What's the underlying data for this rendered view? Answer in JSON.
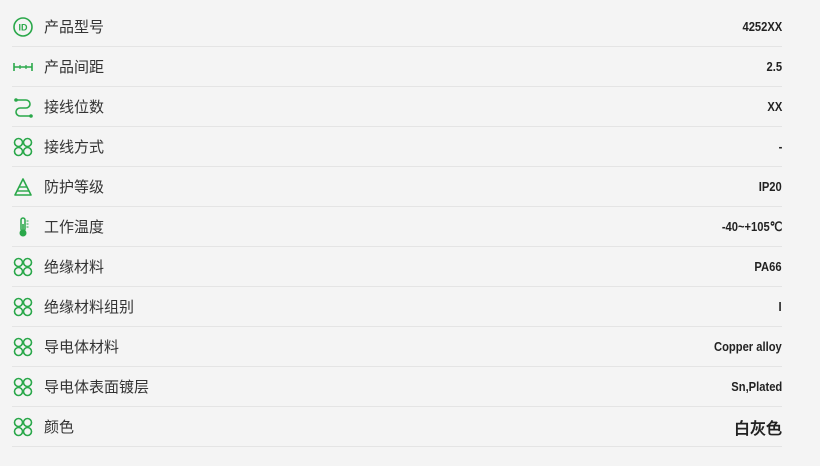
{
  "accent_color": "#2aa84a",
  "specs": [
    {
      "icon": "id-icon",
      "label": "产品型号",
      "value": "4252XX"
    },
    {
      "icon": "pitch-icon",
      "label": "产品间距",
      "value": "2.5"
    },
    {
      "icon": "wiring-icon",
      "label": "接线位数",
      "value": "XX"
    },
    {
      "icon": "clover-icon",
      "label": "接线方式",
      "value": "-"
    },
    {
      "icon": "cone-icon",
      "label": "防护等级",
      "value": "IP20"
    },
    {
      "icon": "thermometer-icon",
      "label": "工作温度",
      "value": "-40~+105℃"
    },
    {
      "icon": "clover-icon",
      "label": "绝缘材料",
      "value": "PA66"
    },
    {
      "icon": "clover-icon",
      "label": "绝缘材料组别",
      "value": "I"
    },
    {
      "icon": "clover-icon",
      "label": "导电体材料",
      "value": "Copper alloy"
    },
    {
      "icon": "clover-icon",
      "label": "导电体表面镀层",
      "value": "Sn,Plated"
    },
    {
      "icon": "clover-icon",
      "label": "颜色",
      "value": "白灰色"
    }
  ]
}
